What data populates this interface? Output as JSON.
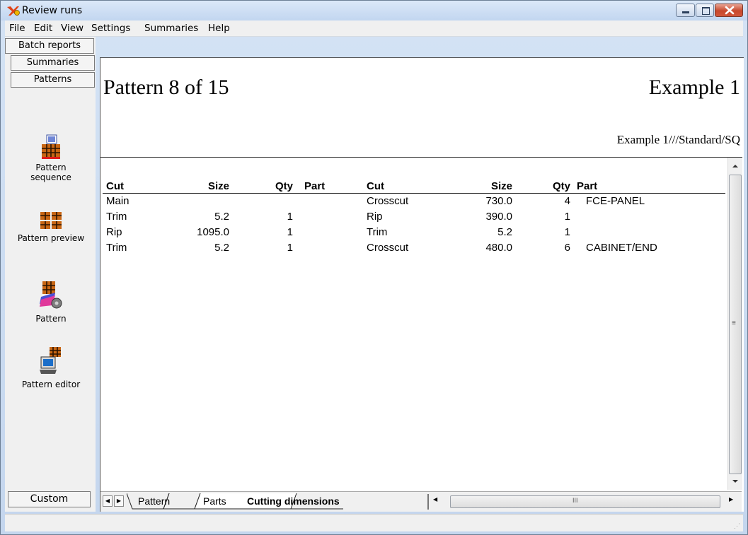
{
  "window": {
    "title": "Review runs"
  },
  "menu": [
    "File",
    "Edit",
    "View",
    "Settings",
    "Summaries",
    "Help"
  ],
  "nav": {
    "batch_reports": "Batch reports",
    "summaries": "Summaries",
    "patterns": "Patterns",
    "custom": "Custom"
  },
  "tools": [
    {
      "label_line1": "Pattern",
      "label_line2": "sequence",
      "icon": "pattern-sequence-icon"
    },
    {
      "label_line1": "Pattern preview",
      "icon": "pattern-preview-icon"
    },
    {
      "label_line1": "Pattern",
      "icon": "pattern-icon"
    },
    {
      "label_line1": "Pattern editor",
      "icon": "pattern-editor-icon"
    }
  ],
  "report": {
    "pattern_title": "Pattern 8 of 15",
    "example_title": "Example 1",
    "example_subtitle": "Example 1///Standard/SQ",
    "headers": [
      "Cut",
      "Size",
      "Qty",
      "Part",
      "Cut",
      "Size",
      "Qty",
      "Part"
    ],
    "rows": [
      {
        "cut1": "Main",
        "size1": "",
        "qty1": "",
        "part1": "",
        "cut2": "Crosscut",
        "size2": "730.0",
        "qty2": "4",
        "part2": "FCE-PANEL"
      },
      {
        "cut1": "Trim",
        "size1": "5.2",
        "qty1": "1",
        "part1": "",
        "cut2": "Rip",
        "size2": "390.0",
        "qty2": "1",
        "part2": ""
      },
      {
        "cut1": "Rip",
        "size1": "1095.0",
        "qty1": "1",
        "part1": "",
        "cut2": "Trim",
        "size2": "5.2",
        "qty2": "1",
        "part2": ""
      },
      {
        "cut1": "Trim",
        "size1": "5.2",
        "qty1": "1",
        "part1": "",
        "cut2": "Crosscut",
        "size2": "480.0",
        "qty2": "6",
        "part2": "CABINET/END"
      }
    ]
  },
  "tabs": [
    "Pattern",
    "Parts",
    "Cutting dimensions"
  ],
  "scroll": {
    "h_grip": "III",
    "v_grip": "≡"
  }
}
